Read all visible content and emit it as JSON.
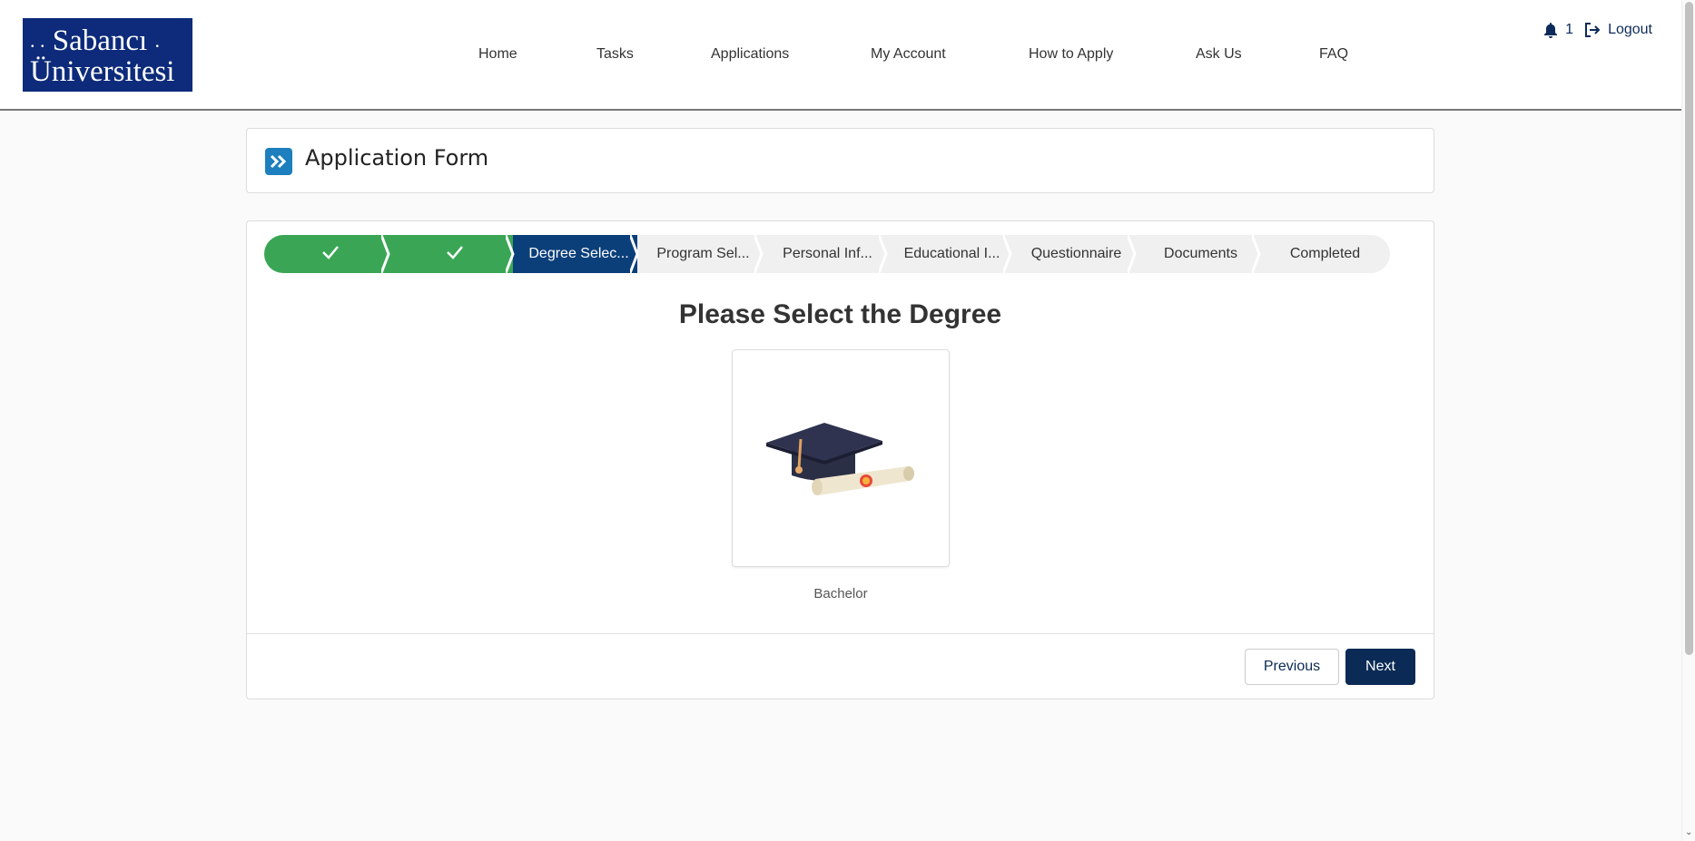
{
  "logo": {
    "line1": "Sabancı",
    "line2": "Üniversitesi"
  },
  "nav": {
    "items": [
      {
        "label": "Home"
      },
      {
        "label": "Tasks"
      },
      {
        "label": "Applications"
      },
      {
        "label": "My Account"
      },
      {
        "label": "How to Apply"
      },
      {
        "label": "Ask Us"
      },
      {
        "label": "FAQ"
      }
    ]
  },
  "topbar": {
    "notification_count": "1",
    "logout_label": "Logout"
  },
  "page": {
    "title": "Application Form"
  },
  "path": {
    "steps": [
      {
        "label": "",
        "state": "complete",
        "icon": "check-icon"
      },
      {
        "label": "",
        "state": "complete",
        "icon": "check-icon"
      },
      {
        "label": "Degree Selec...",
        "state": "current"
      },
      {
        "label": "Program Sel...",
        "state": "upcoming"
      },
      {
        "label": "Personal Inf...",
        "state": "upcoming"
      },
      {
        "label": "Educational I...",
        "state": "upcoming"
      },
      {
        "label": "Questionnaire",
        "state": "upcoming"
      },
      {
        "label": "Documents",
        "state": "upcoming"
      },
      {
        "label": "Completed",
        "state": "upcoming"
      }
    ]
  },
  "main": {
    "heading": "Please Select the Degree",
    "degree_option": {
      "label": "Bachelor",
      "icon": "graduation-cap-icon"
    }
  },
  "buttons": {
    "previous": "Previous",
    "next": "Next"
  },
  "colors": {
    "complete": "#3aa655",
    "current": "#0b3f7a",
    "upcoming": "#f0f0f0",
    "primary_button": "#0b2a55",
    "logo_bg": "#0d2b7a"
  }
}
